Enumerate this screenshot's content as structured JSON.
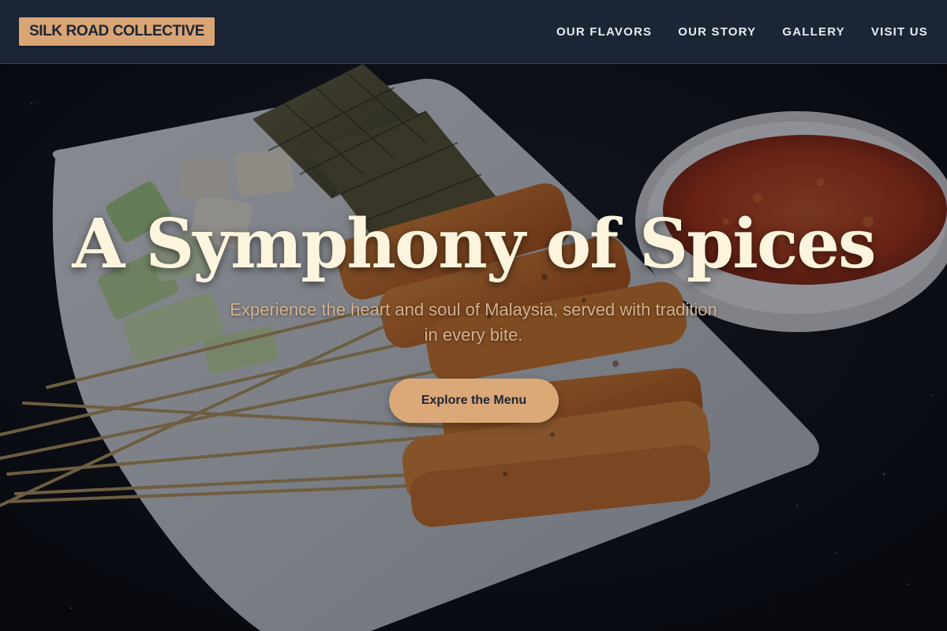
{
  "nav": {
    "brand": "SILK ROAD COLLECTIVE",
    "links": [
      "OUR FLAVORS",
      "OUR STORY",
      "GALLERY",
      "VISIT US"
    ]
  },
  "hero": {
    "title": "A Symphony of Spices",
    "subtitle": "Experience the heart and soul of Malaysia, served with tradition in every bite.",
    "cta_label": "Explore the Menu",
    "background_image": "satay-platter-photo"
  },
  "colors": {
    "nav_bg": "#1c2535",
    "brand_bg": "#d9a574",
    "accent": "#dba878",
    "title": "#fcf4dc",
    "subtitle": "#d4b08c"
  }
}
